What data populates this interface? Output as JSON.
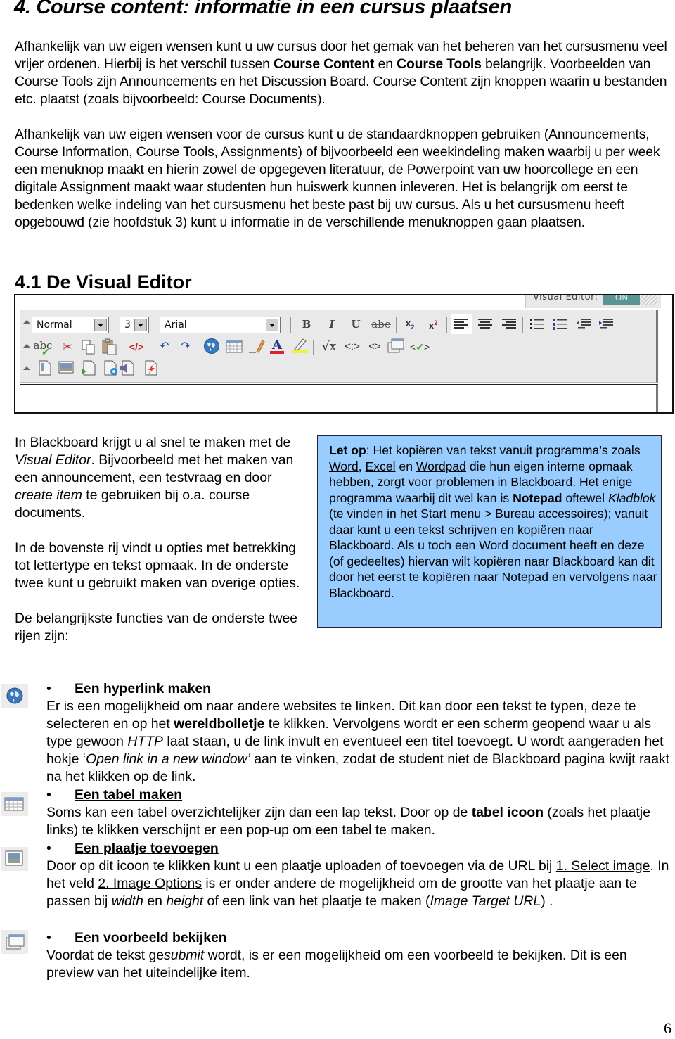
{
  "heading": "4. Course content: informatie in een cursus plaatsen",
  "intro": {
    "p1_a": "Afhankelijk van uw eigen wensen kunt u uw cursus door het gemak van het beheren van het cursusmenu veel vrijer ordenen. Hierbij is het verschil tussen ",
    "p1_b1": "Course Content",
    "p1_c": " en ",
    "p1_b2": "Course Tools",
    "p1_d": " belangrijk. Voorbeelden van Course Tools zijn Announcements en het Discussion Board. Course Content zijn knoppen waarin u bestanden etc. plaatst (zoals bijvoorbeeld: Course Documents).",
    "p2": "Afhankelijk van uw eigen wensen voor de cursus kunt u de standaardknoppen gebruiken (Announcements, Course Information, Course Tools, Assignments) of bijvoorbeeld een weekindeling maken waarbij u per week een menuknop maakt en hierin zowel de opgegeven literatuur, de Powerpoint van uw hoorcollege en een digitale Assignment maakt waar studenten hun huiswerk kunnen inleveren. Het is belangrijk om eerst te bedenken welke indeling van het cursusmenu het beste past bij uw cursus. Als u het cursusmenu heeft opgebouwd (zie hoofdstuk 3) kunt u informatie in de verschillende menuknoppen gaan plaatsen."
  },
  "section_heading": "4.1 De Visual Editor",
  "editor": {
    "toggle_label": "Visual Editor:",
    "toggle_value": "ON",
    "format_select": "Normal",
    "size_select": "3",
    "font_select": "Arial",
    "row1_icons": [
      "bold-icon",
      "italic-icon",
      "underline-icon",
      "strikethrough-icon",
      "subscript-icon",
      "superscript-icon",
      "align-left-icon",
      "align-center-icon",
      "align-right-icon",
      "numbered-list-icon",
      "bullet-list-icon",
      "outdent-icon",
      "indent-icon"
    ],
    "row2_icons": [
      "spellcheck-icon",
      "cut-icon",
      "copy-icon",
      "paste-icon",
      "remove-format-icon",
      "undo-icon",
      "redo-icon",
      "hyperlink-globe-icon",
      "table-icon",
      "draw-line-icon",
      "font-color-icon",
      "highlight-icon",
      "math-icon",
      "html-tag-icon",
      "source-code-icon",
      "preview-icon",
      "validate-html-icon"
    ],
    "row3_icons": [
      "attach-file-icon",
      "insert-image-icon",
      "insert-media-icon",
      "insert-quicktime-icon",
      "insert-audio-icon",
      "insert-flash-icon"
    ],
    "glyphs": {
      "bold": "B",
      "italic": "I",
      "underline": "U",
      "strike": "abe",
      "sub": "x",
      "sub_idx": "2",
      "sup": "x",
      "sup_idx": "2",
      "spell": "abc",
      "math": "√x"
    }
  },
  "left_column": {
    "p1_a": "In Blackboard krijgt u al snel te maken met de ",
    "p1_i1": "Visual Editor",
    "p1_b": ". Bijvoorbeeld met het maken van een announcement, een testvraag en door ",
    "p1_i2": "create item",
    "p1_c": " te gebruiken bij o.a. course documents.",
    "p2": "In de bovenste rij vindt u opties met betrekking tot lettertype en tekst opmaak. In de onderste twee kunt u gebruikt maken van overige opties.",
    "p3": "De belangrijkste functies van de onderste twee rijen zijn:"
  },
  "note": {
    "bg_color": "#99ccff",
    "label": "Let op",
    "t1": ": Het kopiëren van tekst vanuit programma’s zoals ",
    "link1": "Word",
    "t2": ", ",
    "link2": "Excel",
    "t3": " en ",
    "link3": "Wordpad",
    "t4": " die hun eigen interne opmaak hebben, zorgt voor problemen in Blackboard. Het enige programma waarbij dit wel kan is ",
    "bold1": "Notepad",
    "t5": " oftewel ",
    "ital1": "Kladblok",
    "t6": " (te vinden in het Start menu > Bureau accessoires); vanuit daar kunt u een tekst schrijven en kopiëren naar Blackboard. Als u toch een Word document heeft en deze (of gedeeltes) hiervan wilt kopiëren naar Blackboard kan dit door het eerst te kopiëren naar Notepad en vervolgens naar Blackboard."
  },
  "functions": [
    {
      "icon": "globe-icon",
      "title": "Een hyperlink maken",
      "b1": "Er is een mogelijkheid om naar andere websites te linken. Dit kan door een tekst te typen, deze te selecteren en op het ",
      "b1_bold": "wereldbolletje",
      "b2": " te klikken. Vervolgens wordt er een scherm geopend waar u als type gewoon ",
      "b2_ital": "HTTP",
      "b3": " laat staan, u de link invult en eventueel een titel toevoegt. U wordt aangeraden het hokje ‘",
      "b3_ital": "Open link in a new window’",
      "b4": " aan te vinken, zodat de student niet de Blackboard pagina kwijt raakt na het klikken op de link."
    },
    {
      "icon": "table-icon",
      "title": "Een tabel maken",
      "b1": "Soms kan een tabel overzichtelijker zijn dan een lap tekst. Door op de ",
      "b1_bold": "tabel icoon",
      "b2": " (zoals het plaatje links) te klikken verschijnt er een pop-up om een tabel te maken."
    },
    {
      "icon": "image-icon",
      "title": "Een plaatje toevoegen",
      "b1": "Door op dit icoon te klikken kunt u een plaatje uploaden of toevoegen via de URL bij ",
      "link1": "1. Select image",
      "b2": ".  In het veld ",
      "link2": "2. Image Options",
      "b3": " is er onder andere de mogelijkheid om de grootte van het plaatje aan te passen bij ",
      "i1": "width",
      "b4": " en ",
      "i2": "height",
      "b5": " of een link van het plaatje te maken (",
      "i3": "Image Target URL",
      "b6": ") ."
    },
    {
      "icon": "preview-icon",
      "title": "Een voorbeeld bekijken",
      "b1": "Voordat de tekst ge",
      "i1": "submit",
      "b2": " wordt, is er een mogelijkheid om een voorbeeld te bekijken. Dit is een preview van het uiteindelijke item."
    }
  ],
  "bullet": "•",
  "page_number": "6"
}
